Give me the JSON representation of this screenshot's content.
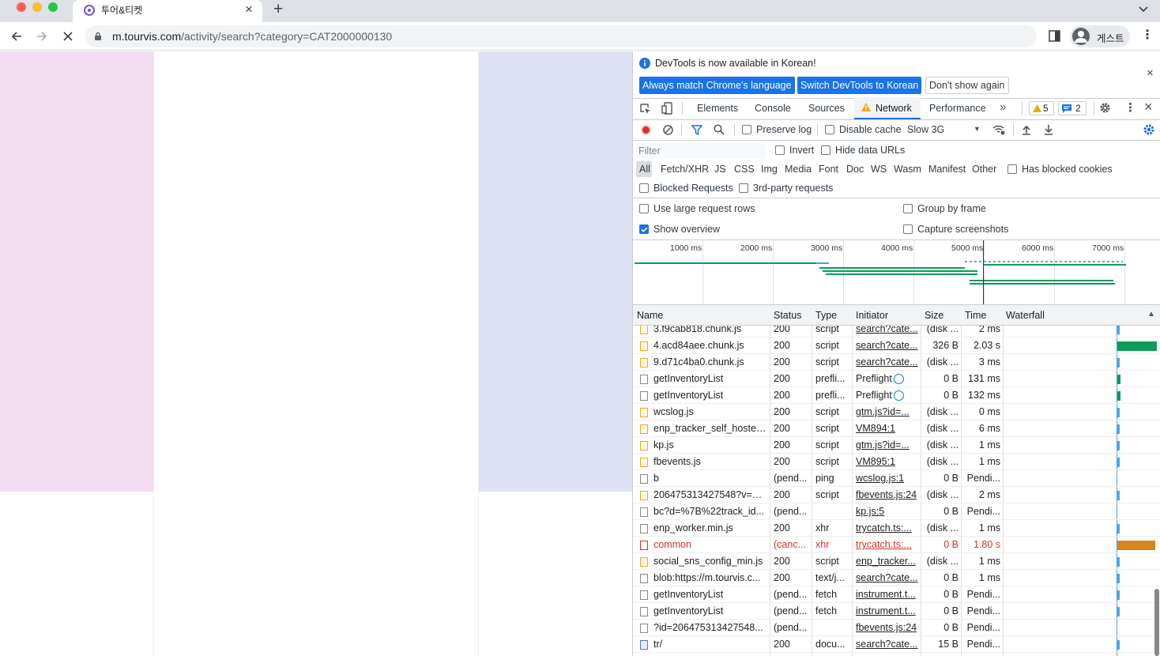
{
  "browser": {
    "tab_title": "투어&티켓",
    "url_host": "m.tourvis.com",
    "url_path": "/activity/search?category=CAT2000000130",
    "profile_label": "게스트"
  },
  "devtools": {
    "infobar": {
      "message": "DevTools is now available in Korean!",
      "btn_match": "Always match Chrome's language",
      "btn_switch": "Switch DevTools to Korean",
      "btn_dont": "Don't show again"
    },
    "tabs": [
      "Elements",
      "Console",
      "Sources",
      "Network",
      "Performance"
    ],
    "warnings_count": "5",
    "messages_count": "2",
    "toolbar": {
      "preserve_log": "Preserve log",
      "disable_cache": "Disable cache",
      "throttle": "Slow 3G"
    },
    "filter_placeholder": "Filter",
    "invert": "Invert",
    "hide_data_urls": "Hide data URLs",
    "types": [
      "All",
      "Fetch/XHR",
      "JS",
      "CSS",
      "Img",
      "Media",
      "Font",
      "Doc",
      "WS",
      "Wasm",
      "Manifest",
      "Other"
    ],
    "has_blocked_cookies": "Has blocked cookies",
    "blocked_requests": "Blocked Requests",
    "third_party": "3rd-party requests",
    "use_large_rows": "Use large request rows",
    "group_by_frame": "Group by frame",
    "show_overview": "Show overview",
    "capture_screenshots": "Capture screenshots",
    "overview_ticks": [
      "1000 ms",
      "2000 ms",
      "3000 ms",
      "4000 ms",
      "5000 ms",
      "6000 ms",
      "7000 ms"
    ],
    "columns": {
      "name": "Name",
      "status": "Status",
      "type": "Type",
      "initiator": "Initiator",
      "size": "Size",
      "time": "Time",
      "waterfall": "Waterfall"
    },
    "rows": [
      {
        "name": "3.f9cab818.chunk.js",
        "status": "200",
        "type": "script",
        "initiator": "search?cate...",
        "size": "(disk ...",
        "time": "2 ms",
        "icon": "js",
        "wf": 0.02
      },
      {
        "name": "4.acd84aee.chunk.js",
        "status": "200",
        "type": "script",
        "initiator": "search?cate...",
        "size": "326 B",
        "time": "2.03 s",
        "icon": "js",
        "wf": 0.9
      },
      {
        "name": "9.d71c4ba0.chunk.js",
        "status": "200",
        "type": "script",
        "initiator": "search?cate...",
        "size": "(disk ...",
        "time": "3 ms",
        "icon": "js",
        "wf": 0.02
      },
      {
        "name": "getInventoryList",
        "status": "200",
        "type": "prefli...",
        "initiator": "Preflight",
        "size": "0 B",
        "time": "131 ms",
        "icon": "plain",
        "wf": 0.08
      },
      {
        "name": "getInventoryList",
        "status": "200",
        "type": "prefli...",
        "initiator": "Preflight",
        "size": "0 B",
        "time": "132 ms",
        "icon": "plain",
        "wf": 0.08
      },
      {
        "name": "wcslog.js",
        "status": "200",
        "type": "script",
        "initiator": "gtm.js?id=...",
        "size": "(disk ...",
        "time": "0 ms",
        "icon": "js",
        "wf": 0.02
      },
      {
        "name": "enp_tracker_self_hosted...",
        "status": "200",
        "type": "script",
        "initiator": "VM894:1",
        "size": "(disk ...",
        "time": "6 ms",
        "icon": "js",
        "wf": 0.02
      },
      {
        "name": "kp.js",
        "status": "200",
        "type": "script",
        "initiator": "gtm.js?id=...",
        "size": "(disk ...",
        "time": "1 ms",
        "icon": "js",
        "wf": 0.02
      },
      {
        "name": "fbevents.js",
        "status": "200",
        "type": "script",
        "initiator": "VM895:1",
        "size": "(disk ...",
        "time": "1 ms",
        "icon": "js",
        "wf": 0.02
      },
      {
        "name": "b",
        "status": "(pend...",
        "type": "ping",
        "initiator": "wcslog.js:1",
        "size": "0 B",
        "time": "Pendi...",
        "icon": "plain",
        "wf": 0
      },
      {
        "name": "206475313427548?v=2....",
        "status": "200",
        "type": "script",
        "initiator": "fbevents.js:24",
        "size": "(disk ...",
        "time": "2 ms",
        "icon": "js",
        "wf": 0.02
      },
      {
        "name": "bc?d=%7B%22track_id...",
        "status": "(pend...",
        "type": "",
        "initiator": "kp.js:5",
        "size": "0 B",
        "time": "Pendi...",
        "icon": "plain",
        "wf": 0
      },
      {
        "name": "enp_worker.min.js",
        "status": "200",
        "type": "xhr",
        "initiator": "trycatch.ts:...",
        "size": "(disk ...",
        "time": "1 ms",
        "icon": "plain",
        "wf": 0.02
      },
      {
        "name": "common",
        "status": "(canc...",
        "type": "xhr",
        "initiator": "trycatch.ts:...",
        "size": "0 B",
        "time": "1.80 s",
        "icon": "err",
        "error": true,
        "wf": 0.85
      },
      {
        "name": "social_sns_config_min.js",
        "status": "200",
        "type": "script",
        "initiator": "enp_tracker...",
        "size": "(disk ...",
        "time": "1 ms",
        "icon": "js",
        "wf": 0.02
      },
      {
        "name": "blob:https://m.tourvis.c...",
        "status": "200",
        "type": "text/j...",
        "initiator": "search?cate...",
        "size": "0 B",
        "time": "1 ms",
        "icon": "plain",
        "wf": 0.02
      },
      {
        "name": "getInventoryList",
        "status": "(pend...",
        "type": "fetch",
        "initiator": "instrument.t...",
        "size": "0 B",
        "time": "Pendi...",
        "icon": "plain",
        "wf": 0.02
      },
      {
        "name": "getInventoryList",
        "status": "(pend...",
        "type": "fetch",
        "initiator": "instrument.t...",
        "size": "0 B",
        "time": "Pendi...",
        "icon": "plain",
        "wf": 0.02
      },
      {
        "name": "?id=206475313427548...",
        "status": "(pend...",
        "type": "",
        "initiator": "fbevents.js:24",
        "size": "0 B",
        "time": "Pendi...",
        "icon": "plain",
        "wf": 0
      },
      {
        "name": "tr/",
        "status": "200",
        "type": "docu...",
        "initiator": "search?cate...",
        "size": "15 B",
        "time": "Pendi...",
        "icon": "doc",
        "wf": 0.02
      }
    ]
  }
}
